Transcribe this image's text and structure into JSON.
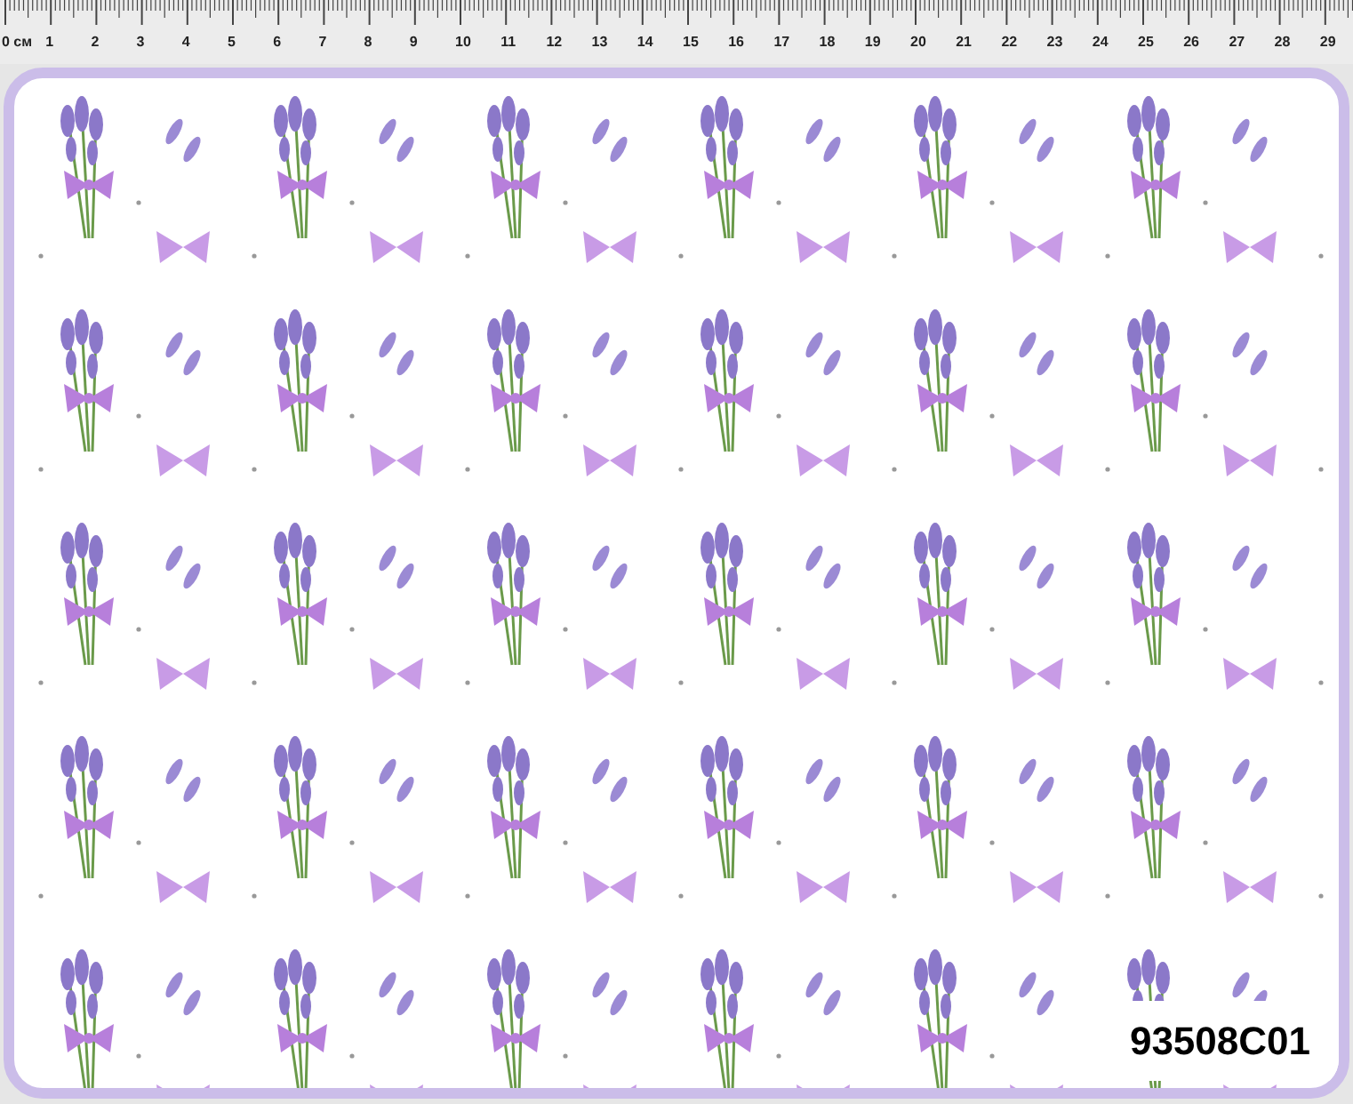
{
  "ruler": {
    "labels": [
      "0 см",
      "1",
      "2",
      "3",
      "4",
      "5",
      "6",
      "7",
      "8",
      "9",
      "10",
      "11",
      "12",
      "13",
      "14",
      "15",
      "16",
      "17",
      "18",
      "19",
      "20",
      "21",
      "22",
      "23",
      "24",
      "25",
      "26",
      "27",
      "28",
      "29"
    ]
  },
  "fabric": {
    "code": "93508C01"
  }
}
